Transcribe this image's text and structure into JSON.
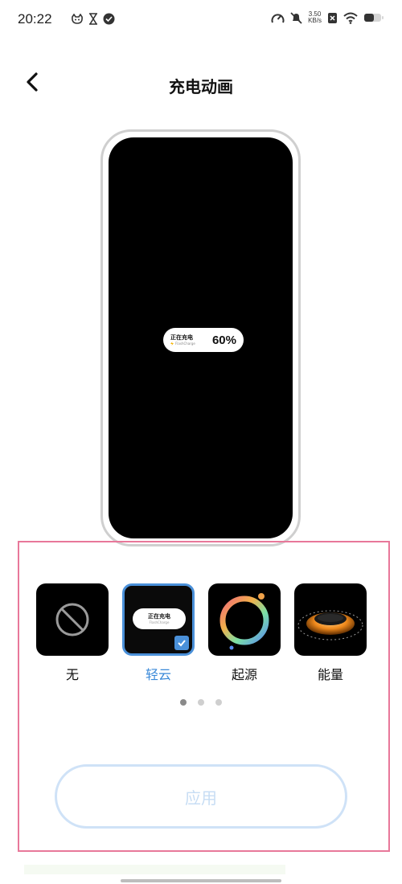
{
  "status_bar": {
    "time": "20:22",
    "net_speed_value": "3.50",
    "net_speed_unit": "KB/s"
  },
  "header": {
    "title": "充电动画"
  },
  "preview": {
    "pill_title": "正在充电",
    "pill_subtitle": "FlashCharge",
    "percent": "60%"
  },
  "options": [
    {
      "label": "无",
      "icon": "disabled-icon",
      "selected": false
    },
    {
      "label": "轻云",
      "icon": "light-cloud-preview",
      "selected": true,
      "thumb_title": "正在充电",
      "thumb_subtitle": "FlashCharge"
    },
    {
      "label": "起源",
      "icon": "origin-ring-preview",
      "selected": false
    },
    {
      "label": "能量",
      "icon": "energy-disc-preview",
      "selected": false
    }
  ],
  "pagination": {
    "pages": 3,
    "current": 1
  },
  "apply_label": "应用",
  "colors": {
    "accent": "#3a89d8",
    "selection_outline": "#e8789a",
    "apply_disabled_text": "#c7ddf4"
  }
}
